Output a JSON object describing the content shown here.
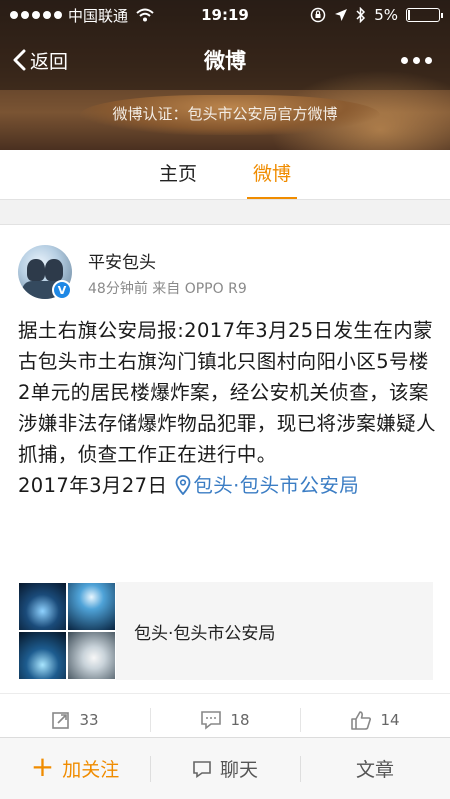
{
  "statusbar": {
    "carrier": "中国联通",
    "time": "19:19",
    "battery": "5%",
    "battery_level": 0.05
  },
  "navbar": {
    "back_label": "返回",
    "title": "微博"
  },
  "header": {
    "verification": "微博认证：包头市公安局官方微博"
  },
  "tabs": [
    {
      "label": "主页"
    },
    {
      "label": "微博"
    }
  ],
  "post": {
    "author": "平安包头",
    "verified_badge": "V",
    "meta": "48分钟前  来自 OPPO R9",
    "body": "据土右旗公安局报:2017年3月25日发生在内蒙古包头市土右旗沟门镇北只图村向阳小区5号楼2单元的居民楼爆炸案，经公安机关侦查，该案涉嫌非法存储爆炸物品犯罪，现已将涉案嫌疑人抓捕，侦查工作正在进行中。",
    "date": "2017年3月27日",
    "location": "包头·包头市公安局",
    "link_card_title": "包头·包头市公安局",
    "actions": {
      "repost": "33",
      "comment": "18",
      "like": "14"
    }
  },
  "bottombar": {
    "follow": "加关注",
    "chat": "聊天",
    "article": "文章"
  },
  "colors": {
    "accent": "#f08c00",
    "link": "#3b7dc4"
  }
}
